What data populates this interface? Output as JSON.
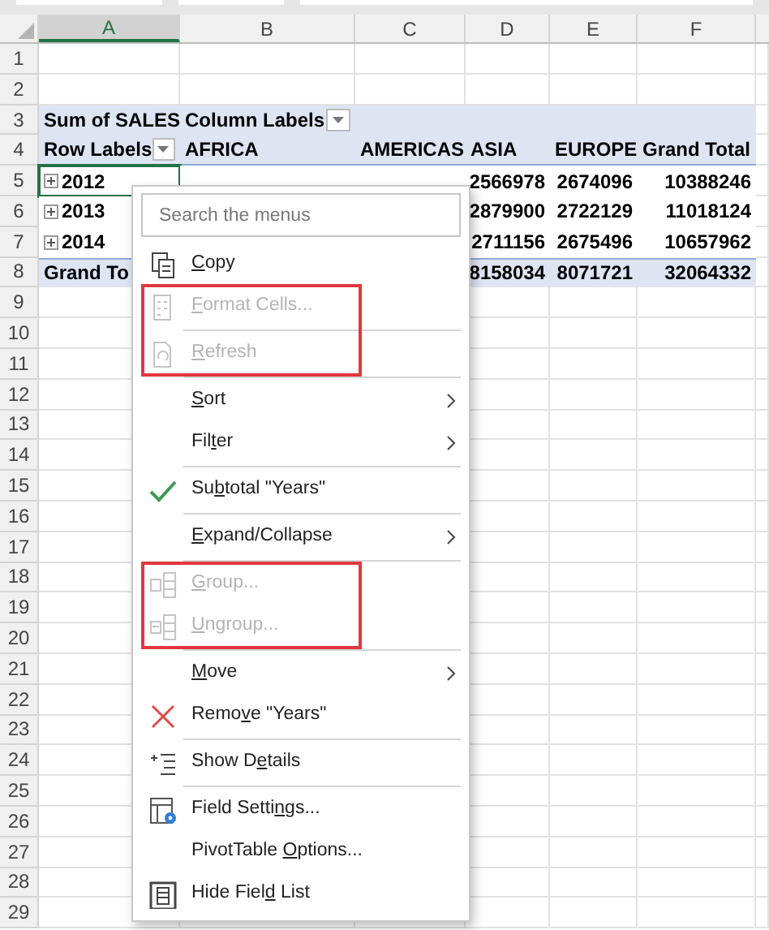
{
  "columns": [
    {
      "label": "A",
      "selected": true
    },
    {
      "label": "B",
      "selected": false
    },
    {
      "label": "C",
      "selected": false
    },
    {
      "label": "D",
      "selected": false
    },
    {
      "label": "E",
      "selected": false
    },
    {
      "label": "F",
      "selected": false
    }
  ],
  "rows": [
    {
      "number": "1",
      "kind": "blank",
      "cells": []
    },
    {
      "number": "2",
      "kind": "blank",
      "cells": []
    },
    {
      "number": "3",
      "kind": "pivot_header",
      "cells": [
        {
          "text": "Sum of SALES"
        },
        {
          "text": "Column Labels",
          "dropdown": true
        }
      ]
    },
    {
      "number": "4",
      "kind": "pivot_header",
      "cells": [
        {
          "text": "Row Labels",
          "dropdown": true
        },
        {
          "text": "AFRICA"
        },
        {
          "text": "AMERICAS"
        },
        {
          "text": "ASIA"
        },
        {
          "text": "EUROPE"
        },
        {
          "text": "Grand Total"
        }
      ]
    },
    {
      "number": "5",
      "kind": "pivot_item",
      "cells": [
        {
          "text": "2012",
          "expandable": true,
          "selected": true
        },
        null,
        null,
        {
          "text": "2566978"
        },
        {
          "text": "2674096"
        },
        {
          "text": "10388246"
        }
      ]
    },
    {
      "number": "6",
      "kind": "pivot_item",
      "cells": [
        {
          "text": "2013",
          "expandable": true,
          "selected": false
        },
        null,
        null,
        {
          "text": "2879900"
        },
        {
          "text": "2722129"
        },
        {
          "text": "11018124"
        }
      ]
    },
    {
      "number": "7",
      "kind": "pivot_item",
      "cells": [
        {
          "text": "2014",
          "expandable": true,
          "selected": false
        },
        null,
        null,
        {
          "text": "2711156"
        },
        {
          "text": "2675496"
        },
        {
          "text": "10657962"
        }
      ]
    },
    {
      "number": "8",
      "kind": "grand_total",
      "cells": [
        {
          "text": "Grand To"
        },
        null,
        null,
        {
          "text": "8158034"
        },
        {
          "text": "8071721"
        },
        {
          "text": "32064332"
        }
      ]
    },
    {
      "number": "9",
      "kind": "blank",
      "cells": []
    },
    {
      "number": "10",
      "kind": "blank",
      "cells": []
    },
    {
      "number": "11",
      "kind": "blank",
      "cells": []
    },
    {
      "number": "12",
      "kind": "blank",
      "cells": []
    },
    {
      "number": "13",
      "kind": "blank",
      "cells": []
    },
    {
      "number": "14",
      "kind": "blank",
      "cells": []
    },
    {
      "number": "15",
      "kind": "blank",
      "cells": []
    },
    {
      "number": "16",
      "kind": "blank",
      "cells": []
    },
    {
      "number": "17",
      "kind": "blank",
      "cells": []
    },
    {
      "number": "18",
      "kind": "blank",
      "cells": []
    },
    {
      "number": "19",
      "kind": "blank",
      "cells": []
    },
    {
      "number": "20",
      "kind": "blank",
      "cells": []
    },
    {
      "number": "21",
      "kind": "blank",
      "cells": []
    },
    {
      "number": "22",
      "kind": "blank",
      "cells": []
    },
    {
      "number": "23",
      "kind": "blank",
      "cells": []
    },
    {
      "number": "24",
      "kind": "blank",
      "cells": []
    },
    {
      "number": "25",
      "kind": "blank",
      "cells": []
    },
    {
      "number": "26",
      "kind": "blank",
      "cells": []
    },
    {
      "number": "27",
      "kind": "blank",
      "cells": []
    },
    {
      "number": "28",
      "kind": "blank",
      "cells": []
    },
    {
      "number": "29",
      "kind": "blank",
      "cells": []
    }
  ],
  "context_menu": {
    "search": {
      "placeholder": "Search the menus"
    },
    "items": [
      {
        "kind": "item",
        "access_key": "C",
        "label_after": "opy",
        "disabled": false,
        "submenu": false,
        "highlighted": false
      },
      {
        "kind": "item",
        "access_key": "F",
        "label_after": "ormat Cells...",
        "disabled": true,
        "submenu": false,
        "highlighted": true
      },
      {
        "kind": "separator"
      },
      {
        "kind": "item",
        "access_key": "R",
        "label_after": "efresh",
        "disabled": true,
        "submenu": false,
        "highlighted": true
      },
      {
        "kind": "separator"
      },
      {
        "kind": "item",
        "access_key": "S",
        "label_after": "ort",
        "disabled": false,
        "submenu": true,
        "highlighted": false
      },
      {
        "kind": "item",
        "label_before": "Fil",
        "access_key": "t",
        "label_after": "er",
        "disabled": false,
        "submenu": true,
        "highlighted": false
      },
      {
        "kind": "separator"
      },
      {
        "kind": "item",
        "label_before": "Su",
        "access_key": "b",
        "label_after": "total \"Years\"",
        "disabled": false,
        "submenu": false,
        "highlighted": false
      },
      {
        "kind": "separator"
      },
      {
        "kind": "item",
        "access_key": "E",
        "label_after": "xpand/Collapse",
        "disabled": false,
        "submenu": true,
        "highlighted": false
      },
      {
        "kind": "separator"
      },
      {
        "kind": "item",
        "access_key": "G",
        "label_after": "roup...",
        "disabled": true,
        "submenu": false,
        "highlighted": true
      },
      {
        "kind": "item",
        "access_key": "U",
        "label_after": "ngroup...",
        "disabled": true,
        "submenu": false,
        "highlighted": true
      },
      {
        "kind": "separator"
      },
      {
        "kind": "item",
        "access_key": "M",
        "label_after": "ove",
        "disabled": false,
        "submenu": true,
        "highlighted": false
      },
      {
        "kind": "item",
        "label_before": "Remo",
        "access_key": "v",
        "label_after": "e \"Years\"",
        "disabled": false,
        "submenu": false,
        "highlighted": false
      },
      {
        "kind": "separator"
      },
      {
        "kind": "item",
        "label_before": "Show D",
        "access_key": "e",
        "label_after": "tails",
        "disabled": false,
        "submenu": false,
        "highlighted": false
      },
      {
        "kind": "separator"
      },
      {
        "kind": "item",
        "label_before": "Field Setti",
        "access_key": "n",
        "label_after": "gs...",
        "disabled": false,
        "submenu": false,
        "highlighted": false
      },
      {
        "kind": "item",
        "label_before": "PivotTable ",
        "access_key": "O",
        "label_after": "ptions...",
        "disabled": false,
        "submenu": false,
        "highlighted": false
      },
      {
        "kind": "item",
        "label_before": "Hide Fiel",
        "access_key": "d",
        "label_after": " List",
        "disabled": false,
        "submenu": false,
        "highlighted": false
      }
    ]
  }
}
